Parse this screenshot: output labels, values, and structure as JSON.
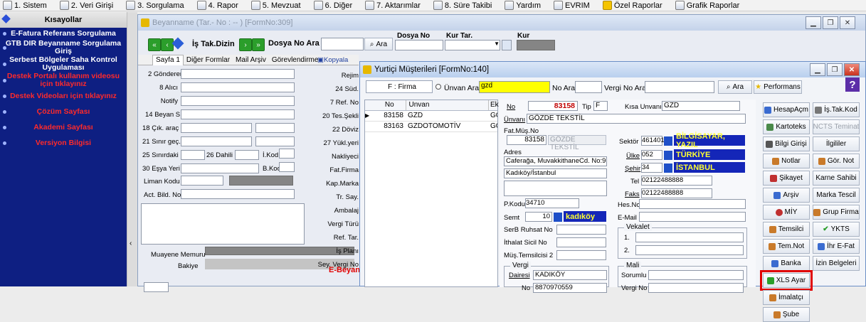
{
  "menubar": [
    {
      "label": "1. Sistem"
    },
    {
      "label": "2. Veri Girişi"
    },
    {
      "label": "3. Sorgulama"
    },
    {
      "label": "4. Rapor"
    },
    {
      "label": "5. Mevzuat"
    },
    {
      "label": "6. Diğer"
    },
    {
      "label": "7. Aktarımlar"
    },
    {
      "label": "8. Süre Takibi"
    },
    {
      "label": "Yardım"
    },
    {
      "label": "EVRIM"
    },
    {
      "label": "Özel Raporlar"
    },
    {
      "label": "Grafik Raporlar"
    }
  ],
  "sidebar": {
    "title": "Kısayollar",
    "items": [
      {
        "label": "E-Fatura Referans Sorgulama",
        "color": "white"
      },
      {
        "label": "GTB DIR Beyanname Sorgulama Giriş",
        "color": "white"
      },
      {
        "label": "Serbest Bölgeler Saha Kontrol Uygulaması",
        "color": "white"
      },
      {
        "label": "Destek Portalı kullanım videosu için tıklayınız",
        "color": "red"
      },
      {
        "label": "Destek Videoları için tıklayınız",
        "color": "red"
      },
      {
        "label": "Çözüm Sayfası",
        "color": "red"
      },
      {
        "label": "Akademi Sayfası",
        "color": "red"
      },
      {
        "label": "Versiyon Bilgisi",
        "color": "red"
      }
    ]
  },
  "bg_window": {
    "title": "Beyanname (Tar.- No : -- ) [FormNo:309]",
    "is_tak_dizin": "İş Tak.Dizin",
    "dosya_no_ara": "Dosya No Ara",
    "ara_button": "Ara",
    "dosya_no": "Dosya No",
    "kur_tar": "Kur Tar.",
    "kur": "Kur",
    "tabs": [
      "Sayfa 1",
      "Diğer Formlar",
      "Mail Arşiv",
      "Görevlendirme",
      "Kopyala"
    ],
    "fields_left": [
      "2 Gönderen",
      "8 Alıcı",
      "Notify",
      "14 Beyan S.",
      "18 Çık. araç",
      "21 Sınır geç.",
      "25 Sınırdaki",
      "30 Eşya Yeri",
      "Liman Kodu",
      "Act. Bild. No"
    ],
    "fields_mid": [
      "26 Dahili",
      "İ.Kod",
      "B.Kod"
    ],
    "fields_right": [
      "Rejim",
      "24 Süd.",
      "7 Ref. No",
      "20 Tes.Şekli",
      "22 Döviz",
      "27 Yükl.yeri",
      "Nakliyeci",
      "Fat.Firma",
      "Kap.Marka",
      "Tr. Say.",
      "Ambalaj",
      "Vergi Türü",
      "Ref. Tar.",
      "İş Planı",
      "Sey. Vergi No"
    ],
    "muayene_memuru": "Muayene Memuru",
    "bakiye": "Bakiye",
    "e_beyan": "E-Beyan"
  },
  "dialog": {
    "title": "Yurtiçi Müşterileri [FormNo:140]",
    "filter_select": "F : Firma",
    "unvan_ara_label": "Ünvan Ara",
    "unvan_ara_value": "gzd",
    "no_ara": "No Ara",
    "vergi_no_ara": "Vergi No Ara",
    "ara_button": "Ara",
    "performans_button": "Performans",
    "table": {
      "headers": [
        "No",
        "Unvan",
        "Ek"
      ],
      "rows": [
        [
          "83158",
          "GZD",
          "GÖ"
        ],
        [
          "83163",
          "GZDOTOMOTİV",
          "GÖ"
        ]
      ]
    },
    "detail": {
      "no_label": "No",
      "no_value": "83158",
      "tip_label": "Tip",
      "tip_value": "F",
      "kisa_unvan_label": "Kısa Unvanı",
      "kisa_unvan_value": "GZD",
      "unvan_label": "Ünvanı",
      "unvan_value": "GÖZDE TEKSTİL",
      "fat_mus_no_label": "Fat.Müş.No",
      "fat_no_value": "83158",
      "fat_name_value": "GÖZDE TEKSTİL",
      "adres_label": "Adres",
      "adres_line1": "Caferağa, MuvakkithaneCd. No:9",
      "adres_line2": "Kadıköy/İstanbul",
      "sektor_label": "Sektör",
      "sektor_code": "461401",
      "sektor_name": "BİLGİSAYAR, YAZIL",
      "ulke_label": "Ülke",
      "ulke_code": "052",
      "ulke_name": "TÜRKİYE",
      "sehir_label": "Şehir",
      "sehir_code": "34",
      "sehir_name": "İSTANBUL",
      "tel_label": "Tel",
      "tel_value": "02122488888",
      "faks_label": "Faks",
      "faks_value": "02122488888",
      "pkodu_label": "P.Kodu",
      "pkodu_value": "34710",
      "semt_label": "Semt",
      "semt_code": "10",
      "semt_name": "kadıköy",
      "hesno_label": "Hes.No",
      "email_label": "E-Mail",
      "serb_label": "SerB Ruhsat No",
      "ithalat_label": "İthalat Sicil No",
      "mus_tem_label": "Müş.Temsilcisi 2",
      "vekalet_label": "Vekalet",
      "vek1": "1.",
      "vek2": "2.",
      "vergi_label": "Vergi",
      "dairesi_label": "Dairesi",
      "dairesi_value": "KADIKÖY",
      "vno_label": "No",
      "vno_value": "8870970559",
      "mali_label": "Mali",
      "sorumlu_label": "Sorumlu",
      "vergi_no_label": "Vergi No"
    },
    "side_buttons": [
      [
        "HesapAçm",
        "İş.Tak.Kod"
      ],
      [
        "Kartoteks",
        "NCTS Teminat"
      ],
      [
        "Bilgi Girişi",
        "İlgililer"
      ],
      [
        "Notlar",
        "Gör. Not"
      ],
      [
        "Şikayet",
        "Karne Sahibi"
      ],
      [
        "Arşiv",
        "Marka Tescil"
      ],
      [
        "MİY",
        "Grup Firma"
      ],
      [
        "Temsilci",
        "YKTS"
      ],
      [
        "Tem.Not",
        "İhr E-Fat"
      ],
      [
        "Banka",
        "İzin Belgeleri"
      ],
      [
        "XLS Ayar",
        ""
      ],
      [
        "İmalatçı",
        ""
      ],
      [
        "Şube",
        ""
      ]
    ]
  }
}
